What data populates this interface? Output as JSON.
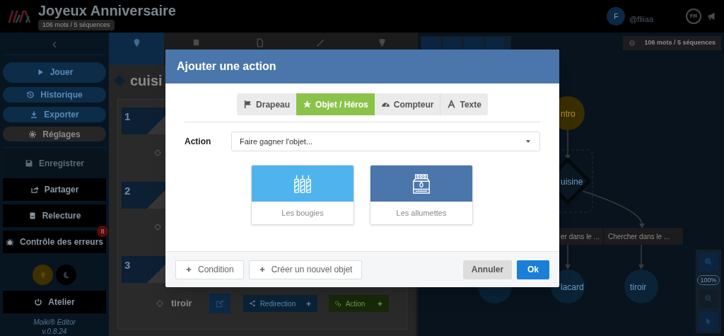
{
  "header": {
    "title": "Joyeux Anniversaire",
    "badge": "106 mots / 5 séquences",
    "user": {
      "initial": "F",
      "handle": "@fliiaa"
    },
    "language": "FR"
  },
  "sidebar": {
    "collapse": "‹",
    "actions": [
      {
        "label": "Jouer",
        "color": "#0c2c47"
      },
      {
        "label": "Historique",
        "color": "#0c2c47"
      },
      {
        "label": "Exporter",
        "color": "#0c2c47"
      },
      {
        "label": "Réglages",
        "color": "#262626"
      }
    ],
    "tools": [
      {
        "label": "Enregistrer",
        "disabled": true
      },
      {
        "label": "Partager",
        "disabled": false
      },
      {
        "label": "Relecture",
        "disabled": false
      },
      {
        "label": "Contrôle des erreurs",
        "disabled": false,
        "badge": "8"
      }
    ],
    "themes": [
      {
        "kind": "light",
        "selected": true
      },
      {
        "kind": "dark",
        "selected": false
      }
    ],
    "workshop": "Atelier",
    "product": "Moiki® Editor",
    "version": "v.0.8.24"
  },
  "editor": {
    "tabs": [
      {
        "selected": true
      },
      {
        "selected": false
      },
      {
        "selected": false
      },
      {
        "selected": false
      },
      {
        "selected": false
      }
    ],
    "heading": "cuisi",
    "steps": [
      {
        "number": "1"
      },
      {
        "number": "2"
      },
      {
        "number": "3",
        "target": "tiroir",
        "buttons": [
          "Redirection",
          "Action"
        ]
      }
    ]
  },
  "canvas": {
    "badge": "106 mots / 5 séquences",
    "zoom": "100%",
    "nodes": [
      {
        "kind": "start",
        "label": "ntro"
      },
      {
        "kind": "sequence",
        "label": "uisine"
      },
      {
        "kind": "choice",
        "label": "er dans le ..."
      },
      {
        "kind": "choice",
        "label": "Chercher dans le ..."
      },
      {
        "kind": "end"
      },
      {
        "kind": "end",
        "label": "lacard"
      },
      {
        "kind": "end",
        "label": "tiroir"
      }
    ]
  },
  "modal": {
    "title": "Ajouter une action",
    "tabs": [
      {
        "label": "Drapeau",
        "selected": false
      },
      {
        "label": "Objet / Héros",
        "selected": true
      },
      {
        "label": "Compteur",
        "selected": false
      },
      {
        "label": "Texte",
        "selected": false
      }
    ],
    "field": {
      "label": "Action",
      "value": "Faire gagner l'objet..."
    },
    "items": [
      {
        "label": "Les bougies",
        "color": "#4fb3ee"
      },
      {
        "label": "Les allumettes",
        "color": "#4a76ab"
      }
    ],
    "footer_left": [
      "Condition",
      "Créer un nouvel objet"
    ],
    "cancel": "Annuler",
    "ok": "Ok"
  }
}
